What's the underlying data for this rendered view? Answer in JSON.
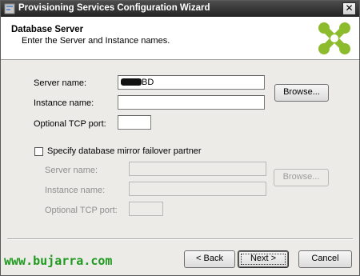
{
  "window": {
    "title": "Provisioning Services Configuration Wizard",
    "close_glyph": "✕",
    "close_icon": "close-icon",
    "app_icon": "wizard-app-icon"
  },
  "header": {
    "heading": "Database Server",
    "subheading": "Enter the Server and Instance names.",
    "logo_icon": "citrix-x-logo",
    "logo_color": "#8dbb2e"
  },
  "form": {
    "server_name_label": "Server name:",
    "server_name_value": "BD",
    "instance_name_label": "Instance name:",
    "instance_name_value": "",
    "tcp_port_label": "Optional TCP port:",
    "tcp_port_value": "",
    "browse_label": "Browse..."
  },
  "mirror": {
    "checkbox_label": "Specify database mirror failover partner",
    "checked": false,
    "server_name_label": "Server name:",
    "server_name_value": "",
    "instance_name_label": "Instance name:",
    "instance_name_value": "",
    "tcp_port_label": "Optional TCP port:",
    "tcp_port_value": "",
    "browse_label": "Browse...",
    "enabled": false
  },
  "footer": {
    "back_label": "< Back",
    "next_label": "Next >",
    "cancel_label": "Cancel"
  },
  "watermark": {
    "text": "www.bujarra.com",
    "color": "#1f9a1f"
  }
}
